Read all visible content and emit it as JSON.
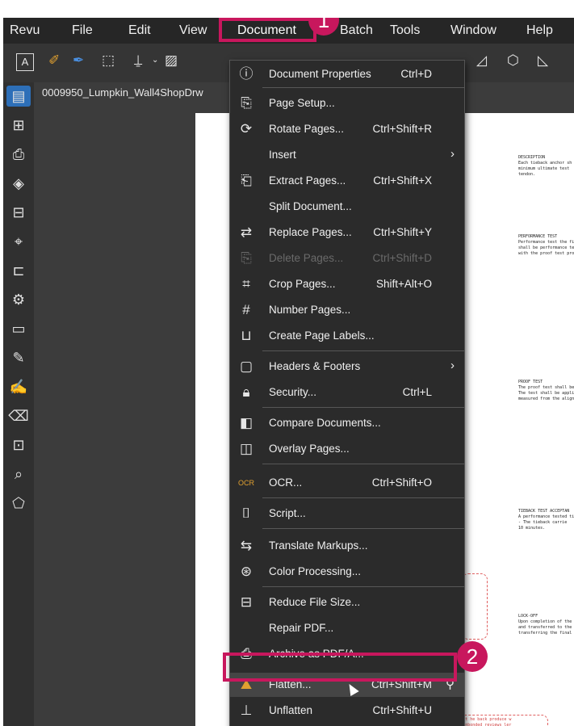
{
  "menubar": {
    "items": [
      "Revu",
      "File",
      "Edit",
      "View",
      "Document",
      "Batch",
      "Tools",
      "Window",
      "Help"
    ]
  },
  "tab": {
    "title": "0009950_Lumpkin_Wall4ShopDrw"
  },
  "document_menu": {
    "items": [
      {
        "label": "Document Properties",
        "shortcut": "Ctrl+D",
        "icon": "info-icon"
      },
      {
        "label": "Page Setup...",
        "shortcut": "",
        "icon": "page-setup-icon"
      },
      {
        "label": "Rotate Pages...",
        "shortcut": "Ctrl+Shift+R",
        "icon": "rotate-pages-icon"
      },
      {
        "label": "Insert",
        "shortcut": "",
        "icon": "",
        "submenu": true
      },
      {
        "label": "Extract Pages...",
        "shortcut": "Ctrl+Shift+X",
        "icon": "extract-pages-icon"
      },
      {
        "label": "Split Document...",
        "shortcut": "",
        "icon": ""
      },
      {
        "label": "Replace Pages...",
        "shortcut": "Ctrl+Shift+Y",
        "icon": "replace-pages-icon"
      },
      {
        "label": "Delete Pages...",
        "shortcut": "Ctrl+Shift+D",
        "icon": "delete-pages-icon",
        "disabled": true
      },
      {
        "label": "Crop Pages...",
        "shortcut": "Shift+Alt+O",
        "icon": "crop-icon"
      },
      {
        "label": "Number Pages...",
        "shortcut": "",
        "icon": "number-pages-icon"
      },
      {
        "label": "Create Page Labels...",
        "shortcut": "",
        "icon": "page-labels-icon"
      },
      {
        "label": "Headers & Footers",
        "shortcut": "",
        "icon": "headers-footers-icon",
        "submenu": true
      },
      {
        "label": "Security...",
        "shortcut": "Ctrl+L",
        "icon": "lock-icon"
      },
      {
        "label": "Compare Documents...",
        "shortcut": "",
        "icon": "compare-icon"
      },
      {
        "label": "Overlay Pages...",
        "shortcut": "",
        "icon": "overlay-icon"
      },
      {
        "label": "OCR...",
        "shortcut": "Ctrl+Shift+O",
        "icon": "ocr-icon"
      },
      {
        "label": "Script...",
        "shortcut": "",
        "icon": "script-icon"
      },
      {
        "label": "Translate Markups...",
        "shortcut": "",
        "icon": "translate-icon"
      },
      {
        "label": "Color Processing...",
        "shortcut": "",
        "icon": "color-processing-icon"
      },
      {
        "label": "Reduce File Size...",
        "shortcut": "",
        "icon": "reduce-size-icon"
      },
      {
        "label": "Repair PDF...",
        "shortcut": "",
        "icon": ""
      },
      {
        "label": "Archive as PDF/A...",
        "shortcut": "",
        "icon": "archive-icon"
      },
      {
        "label": "Flatten...",
        "shortcut": "Ctrl+Shift+M",
        "icon": "flatten-icon",
        "highlighted": true
      },
      {
        "label": "Unflatten",
        "shortcut": "Ctrl+Shift+U",
        "icon": "unflatten-icon"
      }
    ]
  },
  "callouts": {
    "step1": "1",
    "step2": "2"
  },
  "document_snippets": {
    "a": "DESCRIPTION\nEach tieback anchor sh\nminimum ultimate test\ntendon.",
    "b": "PERFORMANCE TEST\nPerformance test the fir\nshall be performance te\nwith the proof test proc",
    "c": "PROOF TEST\nThe proof test shall be\nThe test shall be applie\nmeasured from the align",
    "d": "TIEBACK TEST ACCEPTAN\nA performance tested ti\n- The tieback carrie\n10 minutes.",
    "e": "LOCK-OFF\nUpon completion of the\nand transferred to the\ntransferring the final s",
    "note": "Provide erection users at he back produce w\nboth the tensioned and unbonded reviews ler"
  },
  "colors": {
    "accent": "#c8175d",
    "menu_bg": "#2b2b2b",
    "menubar_bg": "#262626"
  }
}
